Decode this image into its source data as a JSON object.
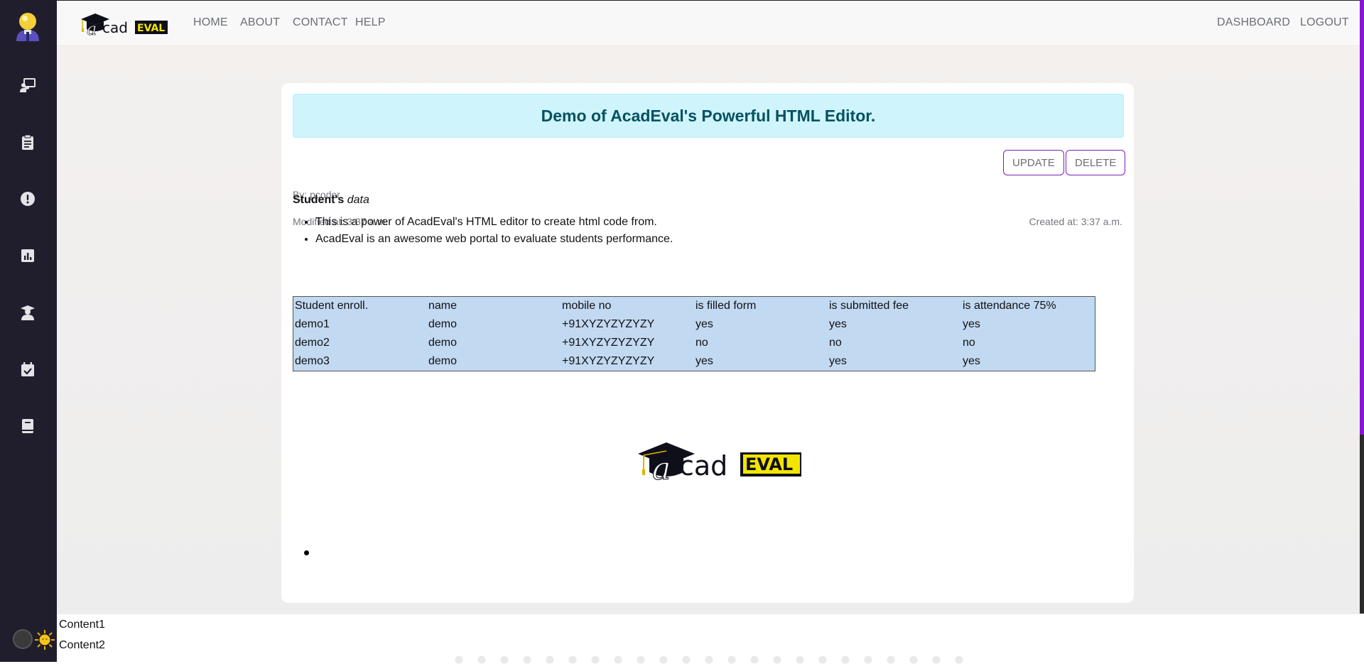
{
  "brand": {
    "logo_text_script": "a",
    "logo_text_cad": "cad",
    "logo_text_eval": "EVAL"
  },
  "nav": {
    "left": [
      "HOME",
      "ABOUT",
      "CONTACT",
      "HELP"
    ],
    "right": [
      "DASHBOARD",
      "LOGOUT"
    ]
  },
  "sidebar": {
    "icons": [
      "user-avatar-icon",
      "teacher-board-icon",
      "clipboard-icon",
      "alert-icon",
      "chart-icon",
      "graduate-icon",
      "calendar-check-icon",
      "book-icon"
    ]
  },
  "post": {
    "title": "Demo of AcadEval's Powerful HTML Editor.",
    "author": "By: pcoder",
    "modified": "Modified at: 3:37 a.m.",
    "created": "Created at: 3:37 a.m.",
    "update_label": "UPDATE",
    "delete_label": "DELETE",
    "heading_bold": "Student's",
    "heading_italic": "data",
    "bullets": [
      "This is a power of AcadEval's HTML editor to create html code from.",
      "AcadEval is an awesome web portal to evaluate students performance."
    ],
    "table": {
      "headers": [
        "Student enroll.",
        "name",
        "mobile no",
        "is filled form",
        "is submitted fee",
        "is attendance 75%"
      ],
      "rows": [
        [
          "demo1",
          "demo",
          "+91XYZYZYZYZY",
          "yes",
          "yes",
          "yes"
        ],
        [
          "demo2",
          "demo",
          "+91XYZYZYZYZY",
          "no",
          "no",
          "no"
        ],
        [
          "demo3",
          "demo",
          "+91XYZYZYZYZY",
          "yes",
          "yes",
          "yes"
        ]
      ]
    }
  },
  "bottom": {
    "content1": "Content1",
    "content2": "Content2"
  },
  "colors": {
    "sidebar": "#201e2c",
    "accent_purple": "#7a1fb8",
    "banner_bg": "#cff4fc",
    "banner_text": "#055160",
    "table_bg": "#c2d9f2",
    "logo_yellow": "#f2e600"
  }
}
